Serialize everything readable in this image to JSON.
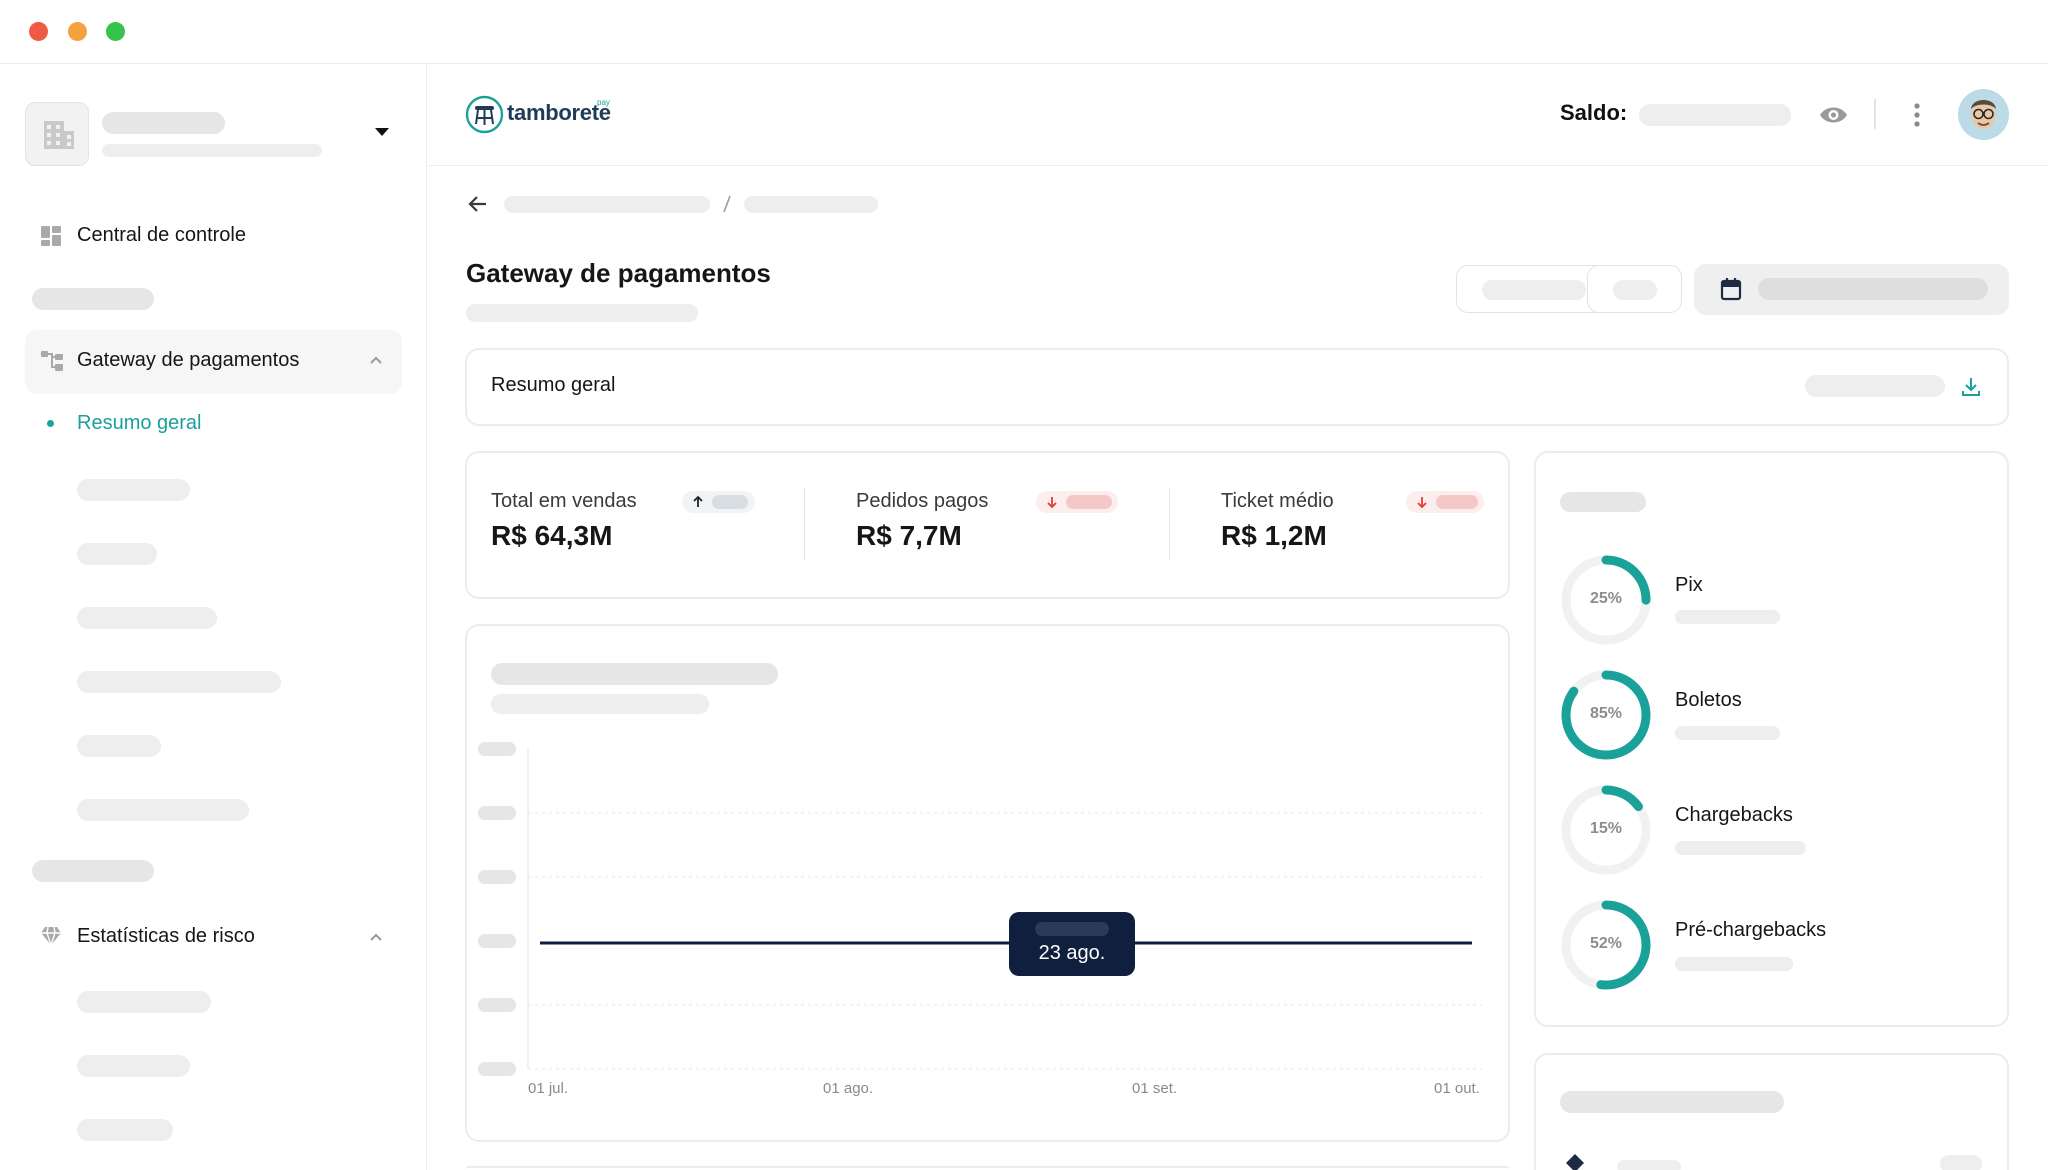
{
  "window": {
    "controls": [
      {
        "name": "close",
        "color": "#ee5b45"
      },
      {
        "name": "minimize",
        "color": "#f3a23d"
      },
      {
        "name": "maximize",
        "color": "#37c24c"
      }
    ]
  },
  "sidebar": {
    "org_icon": "building-icon",
    "items": [
      {
        "label": "Central de controle",
        "icon": "dashboard-icon"
      },
      {
        "label": "Gateway de pagamentos",
        "icon": "gateway-icon"
      },
      {
        "label": "Estatísticas de risco",
        "icon": "diamond-icon"
      }
    ],
    "active_sub_item": "Resumo geral"
  },
  "header": {
    "logo_text": "tamborete",
    "logo_superscript": "pay",
    "balance_label": "Saldo:",
    "icons": [
      "eye-icon",
      "more-vertical-icon",
      "avatar"
    ]
  },
  "page": {
    "title": "Gateway de pagamentos",
    "summary_title": "Resumo geral"
  },
  "stats": [
    {
      "label": "Total em vendas",
      "value": "R$ 64,3M",
      "trend": "up",
      "trend_color": "#222222"
    },
    {
      "label": "Pedidos pagos",
      "value": "R$ 7,7M",
      "trend": "down",
      "trend_color": "#e53935"
    },
    {
      "label": "Ticket médio",
      "value": "R$ 1,2M",
      "trend": "down",
      "trend_color": "#e53935"
    }
  ],
  "chart": {
    "x_ticks": [
      "01 jul.",
      "01 ago.",
      "01 set.",
      "01 out."
    ],
    "tooltip_label": "23 ago."
  },
  "payment_methods": [
    {
      "label": "Pix",
      "percent_label": "25%",
      "percent": 25
    },
    {
      "label": "Boletos",
      "percent_label": "85%",
      "percent": 85
    },
    {
      "label": "Chargebacks",
      "percent_label": "15%",
      "percent": 15
    },
    {
      "label": "Pré-chargebacks",
      "percent_label": "52%",
      "percent": 52
    }
  ],
  "colors": {
    "accent": "#1aa19a",
    "tooltip_bg": "#0f1f3d",
    "skeleton": "#e6e6e6"
  }
}
